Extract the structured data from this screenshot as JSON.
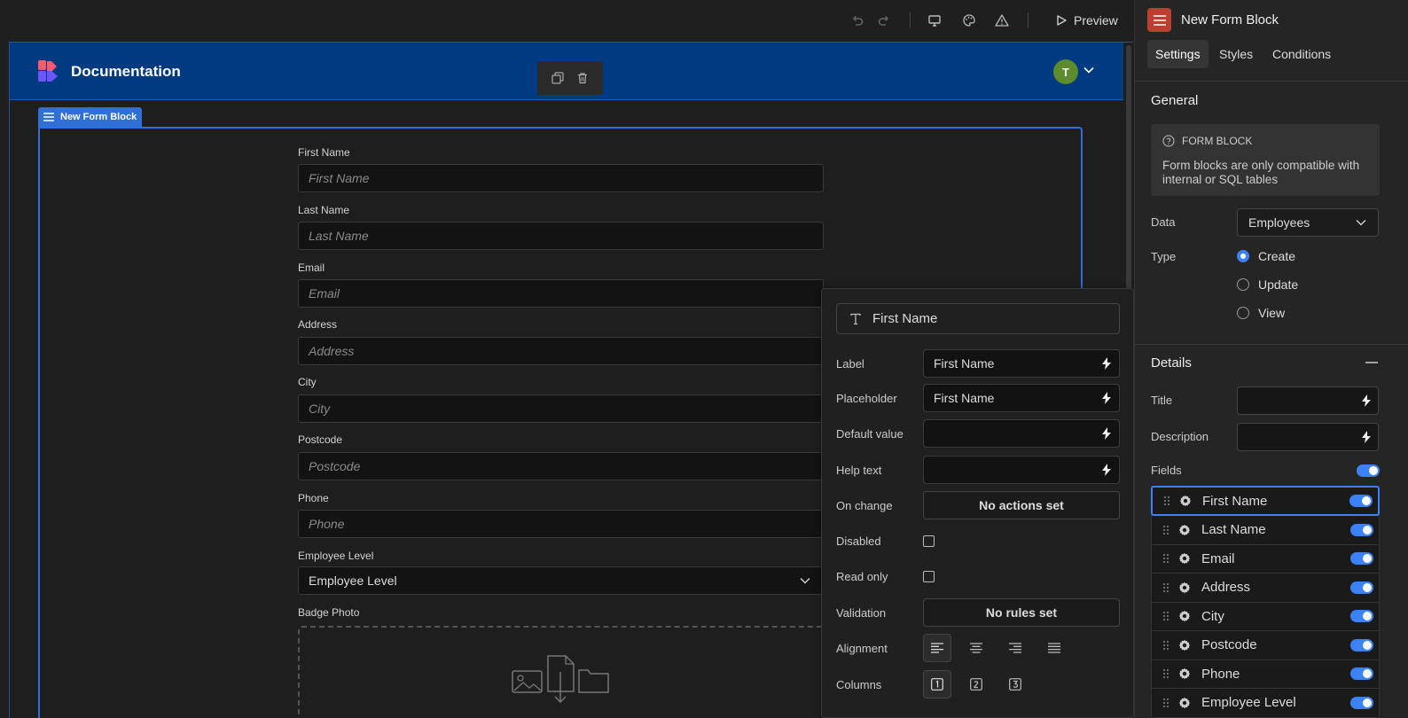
{
  "toolbar": {
    "preview_label": "Preview"
  },
  "navbar": {
    "app_title": "Documentation",
    "avatar_initial": "T"
  },
  "block_tag": "New Form Block",
  "form": {
    "fields": [
      {
        "label": "First Name",
        "placeholder": "First Name"
      },
      {
        "label": "Last Name",
        "placeholder": "Last Name"
      },
      {
        "label": "Email",
        "placeholder": "Email"
      },
      {
        "label": "Address",
        "placeholder": "Address"
      },
      {
        "label": "City",
        "placeholder": "City"
      },
      {
        "label": "Postcode",
        "placeholder": "Postcode"
      },
      {
        "label": "Phone",
        "placeholder": "Phone"
      }
    ],
    "select": {
      "label": "Employee Level",
      "value": "Employee Level"
    },
    "badge": {
      "label": "Badge Photo"
    }
  },
  "popover": {
    "field_name": "First Name",
    "label_label": "Label",
    "label_value": "First Name",
    "placeholder_label": "Placeholder",
    "placeholder_value": "First Name",
    "default_label": "Default value",
    "help_label": "Help text",
    "onchange_label": "On change",
    "onchange_button": "No actions set",
    "disabled_label": "Disabled",
    "readonly_label": "Read only",
    "validation_label": "Validation",
    "validation_button": "No rules set",
    "alignment_label": "Alignment",
    "columns_label": "Columns"
  },
  "panel": {
    "title": "New Form Block",
    "tabs": [
      "Settings",
      "Styles",
      "Conditions"
    ],
    "general_title": "General",
    "info_title": "FORM BLOCK",
    "info_text": "Form blocks are only compatible with internal or SQL tables",
    "data_label": "Data",
    "data_value": "Employees",
    "type_label": "Type",
    "type_options": [
      "Create",
      "Update",
      "View"
    ],
    "type_selected": "Create",
    "details_title": "Details",
    "title_label": "Title",
    "description_label": "Description",
    "fields_label": "Fields",
    "field_items": [
      "First Name",
      "Last Name",
      "Email",
      "Address",
      "City",
      "Postcode",
      "Phone",
      "Employee Level"
    ]
  },
  "colors": {
    "accent": "#3b82f6",
    "navbar": "#003a80",
    "block_outline": "#2f6fd6",
    "panel_icon": "#bb4030",
    "avatar": "#5f8b2f"
  }
}
